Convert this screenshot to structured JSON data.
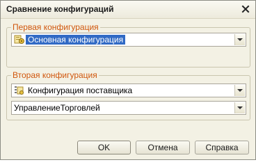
{
  "window": {
    "title": "Сравнение конфигураций",
    "close_icon": "close-icon"
  },
  "group1": {
    "legend": "Первая конфигурация",
    "combo_value": "Основная конфигурация",
    "combo_icon": "configuration-icon"
  },
  "group2": {
    "legend": "Вторая конфигурация",
    "combo1_value": "Конфигурация поставщика",
    "combo1_icon": "vendor-configuration-icon",
    "combo2_value": "УправлениеТорговлей"
  },
  "buttons": {
    "ok": "OK",
    "cancel": "Отмена",
    "help": "Справка"
  }
}
